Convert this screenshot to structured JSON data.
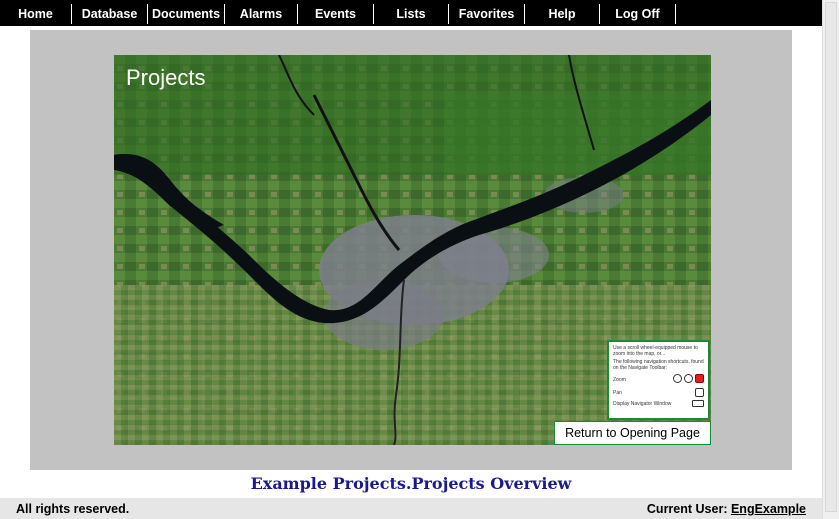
{
  "nav": {
    "items": [
      "Home",
      "Database",
      "Documents",
      "Alarms",
      "Events",
      "Lists",
      "Favorites",
      "Help",
      "Log Off"
    ]
  },
  "map": {
    "title": "Projects",
    "help": {
      "intro": "Use a scroll wheel-equipped mouse to zoom into the map, or...",
      "shortcuts_intro": "The following navigation shortcuts, found on the Navigate Toolbar:",
      "zoom_label": "Zoom",
      "pan_label": "Pan",
      "navigator_label": "Display Navigator Window"
    },
    "return_button": "Return to Opening Page"
  },
  "caption": "Example Projects.Projects Overview",
  "footer": {
    "rights": "All rights reserved.",
    "user_label": "Current User:",
    "user_name": "EngExample"
  }
}
